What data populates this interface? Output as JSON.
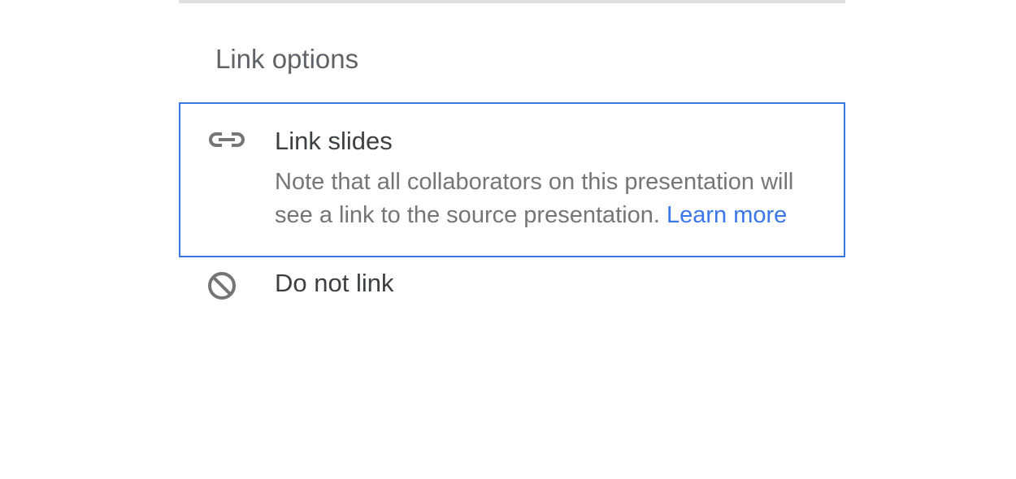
{
  "section": {
    "title": "Link options"
  },
  "options": {
    "link": {
      "title": "Link slides",
      "description": "Note that all collaborators on this presentation will see a link to the source presentation. ",
      "learn_more": "Learn more"
    },
    "no_link": {
      "title": "Do not link"
    }
  }
}
